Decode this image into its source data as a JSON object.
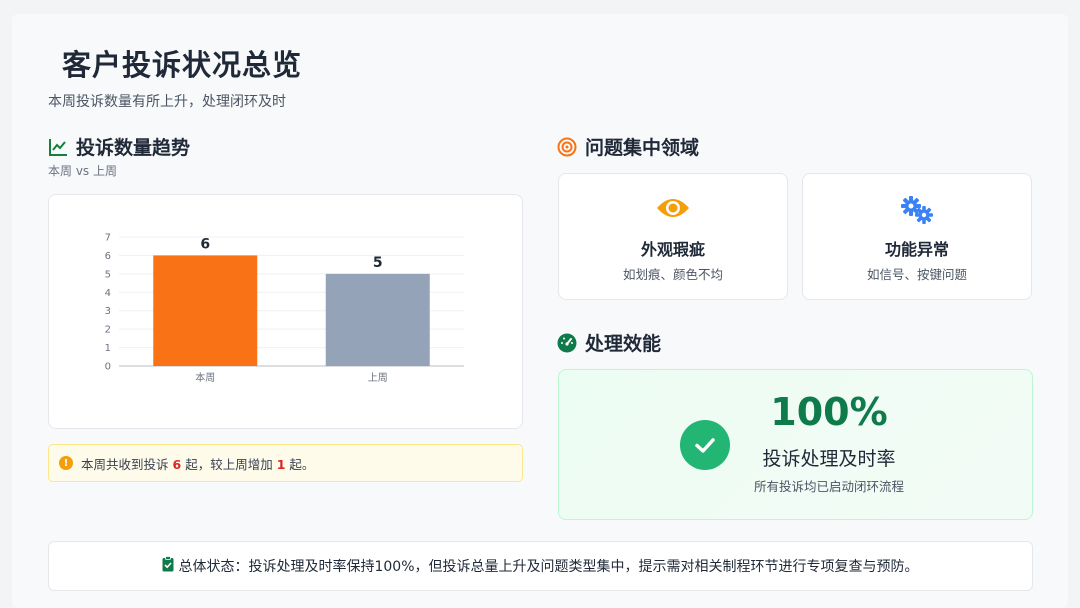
{
  "header": {
    "title": "客户投诉状况总览",
    "subtitle": "本周投诉数量有所上升，处理闭环及时"
  },
  "trend": {
    "heading": "投诉数量趋势",
    "subheading": "本周 vs 上周",
    "icon": "line-chart-icon"
  },
  "chart_data": {
    "type": "bar",
    "categories": [
      "本周",
      "上周"
    ],
    "values": [
      6,
      5
    ],
    "colors": [
      "#f97316",
      "#94a3b8"
    ],
    "ylim": [
      0,
      7
    ],
    "yticks": [
      "0",
      "1",
      "2",
      "3",
      "4",
      "5",
      "6",
      "7"
    ],
    "data_labels": [
      "6",
      "5"
    ],
    "grid": true,
    "title": "",
    "xlabel": "",
    "ylabel": ""
  },
  "note": {
    "prefix": "本周共收到投诉",
    "this_week": "6",
    "middle": "起，较上周增加",
    "increase": "1",
    "suffix": "起。"
  },
  "areas": {
    "heading": "问题集中领域",
    "icon": "target-icon",
    "items": [
      {
        "title": "外观瑕疵",
        "desc": "如划痕、颜色不均",
        "icon": "eye-icon",
        "color": "#f59e0b"
      },
      {
        "title": "功能异常",
        "desc": "如信号、按键问题",
        "icon": "gears-icon",
        "color": "#3b82f6"
      }
    ]
  },
  "efficiency": {
    "heading": "处理效能",
    "icon": "gauge-icon",
    "value": "100%",
    "label": "投诉处理及时率",
    "desc": "所有投诉均已启动闭环流程"
  },
  "summary": {
    "icon": "clipboard-check-icon",
    "text": "总体状态：投诉处理及时率保持100%，但投诉总量上升及问题类型集中，提示需对相关制程环节进行专项复查与预防。"
  },
  "colors": {
    "accent_green": "#0f7a4a",
    "accent_orange": "#f97316",
    "gray_bar": "#94a3b8"
  }
}
